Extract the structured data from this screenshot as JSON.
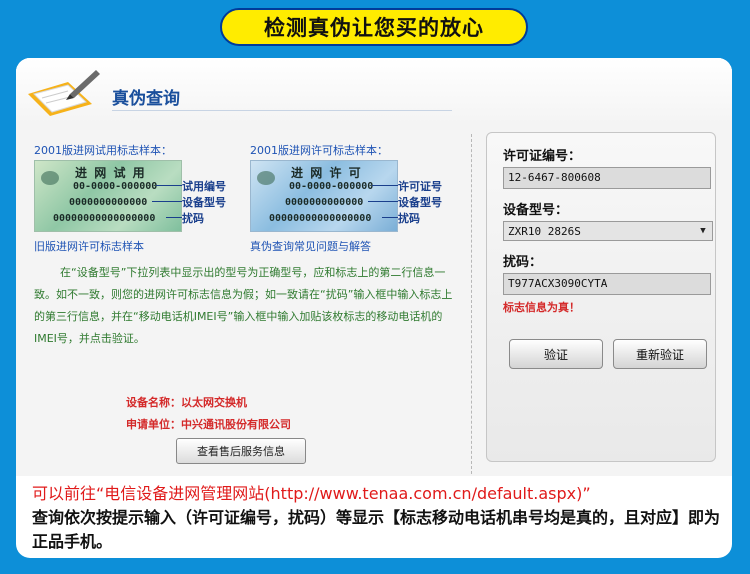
{
  "banner": {
    "text": "检测真伪让您买的放心"
  },
  "page": {
    "title": "真伪查询"
  },
  "samples": {
    "trial": {
      "label": "2001版进网试用标志样本：",
      "card_title": "进 网 试 用",
      "card_line1": "00-0000-000000",
      "card_line2": "0000000000000",
      "card_line3": "00000000000000000",
      "callouts": [
        "试用编号",
        "设备型号",
        "扰码"
      ],
      "link": "旧版进网许可标志样本"
    },
    "license": {
      "label": "2001版进网许可标志样本：",
      "card_title": "进 网 许 可",
      "card_line1": "00-0000-000000",
      "card_line2": "0000000000000",
      "card_line3": "00000000000000000",
      "callouts": [
        "许可证号",
        "设备型号",
        "扰码"
      ],
      "link": "真伪查询常见问题与解答"
    }
  },
  "instructions": "在“设备型号”下拉列表中显示出的型号为正确型号，应和标志上的第二行信息一致。如不一致，则您的进网许可标志信息为假；如一致请在“扰码”输入框中输入标志上的第三行信息，并在“移动电话机IMEI号”输入框中输入加贴该枚标志的移动电话机的IMEI号，并点击验证。",
  "device_info": {
    "name_key": "设备名称：",
    "name_value": "以太网交换机",
    "applicant_key": "申请单位：",
    "applicant_value": "中兴通讯股份有限公司",
    "service_button": "查看售后服务信息"
  },
  "form": {
    "license_label": "许可证编号：",
    "license_value": "12-6467-800608",
    "model_label": "设备型号：",
    "model_value": "ZXR10 2826S",
    "scramble_label": "扰码：",
    "scramble_value": "T977ACX3090CYTA",
    "result": "标志信息为真！",
    "verify_button": "验证",
    "reverify_button": "重新验证"
  },
  "footer": {
    "line1": "可以前往“电信设备进网管理网站(http://www.tenaa.com.cn/default.aspx)”",
    "line2": "查询依次按提示输入（许可证编号，扰码）等显示【标志移动电话机串号均是真的，且对应】即为正品手机。"
  },
  "colors": {
    "background": "#0d8fd8",
    "banner": "#ffec00",
    "title": "#1a4f9c",
    "alert_red": "#d42a2a",
    "instruction_green": "#2f7a2f"
  }
}
